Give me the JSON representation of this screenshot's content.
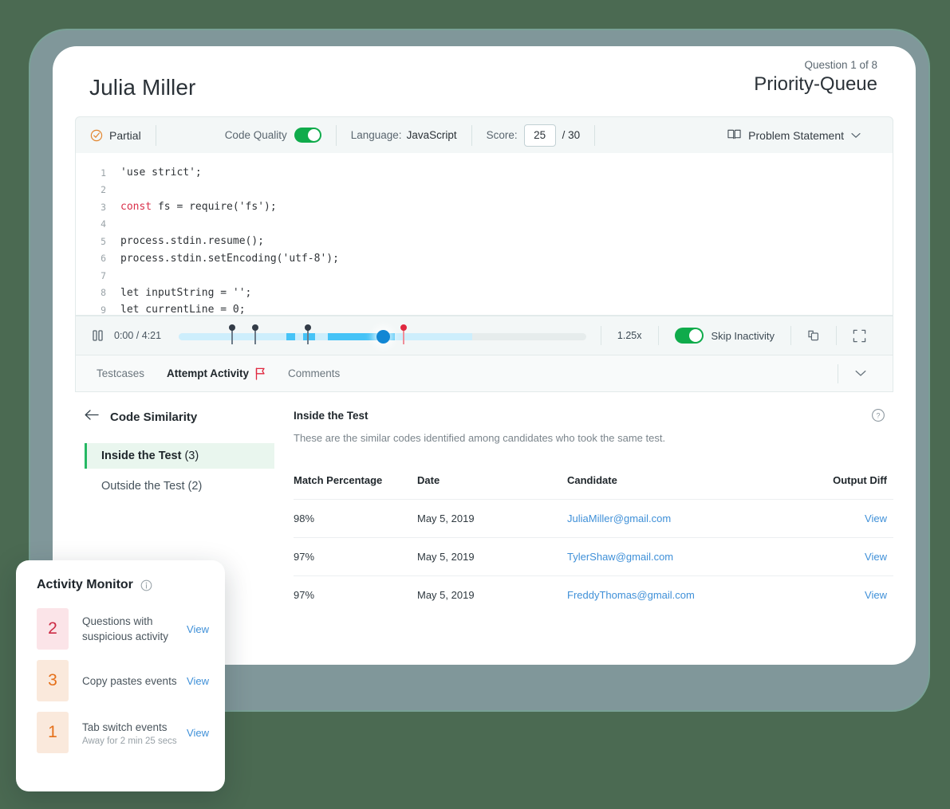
{
  "header": {
    "candidate_name": "Julia Miller",
    "question_count": "Question 1 of 8",
    "question_title": "Priority-Queue"
  },
  "toolbar": {
    "status": "Partial",
    "status_icon": "circle-check-icon",
    "code_quality_label": "Code Quality",
    "code_quality_on": true,
    "language_label": "Language:",
    "language_value": "JavaScript",
    "score_label": "Score:",
    "score_value": "25",
    "score_total": "/ 30",
    "problem_statement_label": "Problem Statement",
    "problem_statement_icon": "book-icon",
    "chevron_icon": "chevron-down-icon"
  },
  "editor": {
    "lines": [
      {
        "n": "1",
        "pre": "'use strict';",
        "kw": "",
        "post": ""
      },
      {
        "n": "2",
        "pre": "",
        "kw": "",
        "post": ""
      },
      {
        "n": "3",
        "pre": "",
        "kw": "const",
        "post": " fs = require('fs');"
      },
      {
        "n": "4",
        "pre": "",
        "kw": "",
        "post": ""
      },
      {
        "n": "5",
        "pre": "process.stdin.resume();",
        "kw": "",
        "post": ""
      },
      {
        "n": "6",
        "pre": "process.stdin.setEncoding('utf-8');",
        "kw": "",
        "post": ""
      },
      {
        "n": "7",
        "pre": "",
        "kw": "",
        "post": ""
      },
      {
        "n": "8",
        "pre": "let inputString = '';",
        "kw": "",
        "post": ""
      },
      {
        "n": "9",
        "pre": "let currentLine = 0;",
        "kw": "",
        "post": ""
      }
    ]
  },
  "playback": {
    "play_state_icon": "pause-icon",
    "timecode": "0:00 / 4:21",
    "speed": "1.25x",
    "skip_inactivity_label": "Skip Inactivity",
    "skip_inactivity_on": true,
    "copy_icon": "copy-icon",
    "fullscreen_icon": "fullscreen-icon",
    "buffered_percent": 72,
    "playhead_percent": 50,
    "active_segments": [
      {
        "start": 26.5,
        "end": 28.5
      },
      {
        "start": 30.5,
        "end": 33.5
      },
      {
        "start": 36.5,
        "end": 53.0
      }
    ],
    "markers": [
      {
        "position": 18.5,
        "color": "dark"
      },
      {
        "position": 31.5,
        "color": "dark"
      },
      {
        "position": 13.0,
        "color": "dark"
      },
      {
        "position": 55.0,
        "color": "red"
      }
    ]
  },
  "tabs": {
    "items": [
      {
        "label": "Testcases",
        "active": false,
        "flag": false
      },
      {
        "label": "Attempt Activity",
        "active": true,
        "flag": true
      },
      {
        "label": "Comments",
        "active": false,
        "flag": false
      }
    ],
    "collapse_icon": "chevron-down-icon"
  },
  "similarity": {
    "back_icon": "arrow-left-icon",
    "section_title": "Code Similarity",
    "nav": [
      {
        "label": "Inside the Test",
        "count": "(3)",
        "active": true
      },
      {
        "label": "Outside the Test",
        "count": "(2)",
        "active": false
      }
    ],
    "content_title": "Inside the Test",
    "content_sub": "These are the similar codes identified among candidates who took the same test.",
    "help_icon": "help-circle-icon",
    "columns": [
      "Match Percentage",
      "Date",
      "Candidate",
      "Output Diff"
    ],
    "rows": [
      {
        "match": "98%",
        "date": "May 5, 2019",
        "candidate": "JuliaMiller@gmail.com",
        "action": "View"
      },
      {
        "match": "97%",
        "date": "May 5, 2019",
        "candidate": "TylerShaw@gmail.com",
        "action": "View"
      },
      {
        "match": "97%",
        "date": "May 5, 2019",
        "candidate": "FreddyThomas@gmail.com",
        "action": "View"
      }
    ]
  },
  "activity_monitor": {
    "title": "Activity Monitor",
    "info_icon": "info-circle-icon",
    "items": [
      {
        "count": "2",
        "tone": "red",
        "label": "Questions with suspicious activity",
        "note": "",
        "action": "View"
      },
      {
        "count": "3",
        "tone": "orange",
        "label": "Copy pastes events",
        "note": "",
        "action": "View"
      },
      {
        "count": "1",
        "tone": "orange",
        "label": "Tab switch events",
        "note": "Away for 2 min 25 secs",
        "action": "View"
      }
    ]
  },
  "colors": {
    "page_background": "#4b6a52",
    "bezel": "#80979a",
    "accent_green": "#0fab4b",
    "accent_blue": "#3f90d8",
    "playhead_blue": "#1287d4",
    "track_active": "#45c3f7",
    "track_buffered": "#cdeefc",
    "status_orange": "#e5701a",
    "badge_red": "#cc2b45"
  }
}
